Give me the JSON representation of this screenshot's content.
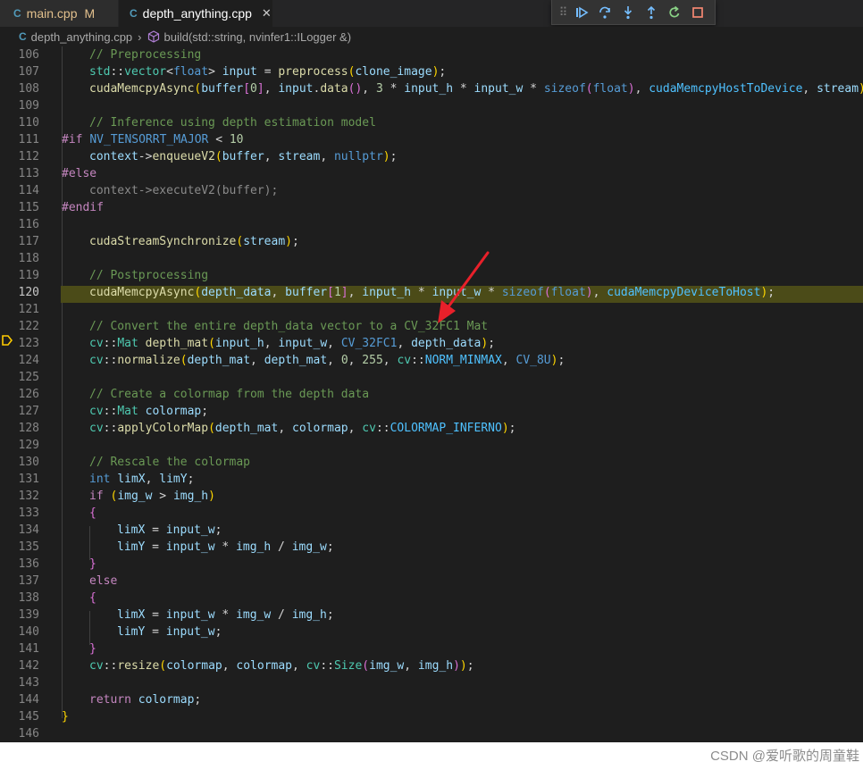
{
  "tabs": [
    {
      "icon": "C",
      "label": "main.cpp",
      "badge": "M"
    },
    {
      "icon": "C",
      "label": "depth_anything.cpp",
      "close": "✕"
    }
  ],
  "breadcrumb": {
    "file": "depth_anything.cpp",
    "symbol": "build(std::string, nvinfer1::ILogger &)"
  },
  "debug_toolbar": {
    "buttons": [
      "continue",
      "step-over",
      "step-into",
      "step-out",
      "restart",
      "stop"
    ]
  },
  "editor": {
    "current_line": 120,
    "line_numbers": [
      "106",
      "107",
      "108",
      "109",
      "110",
      "111",
      "112",
      "113",
      "114",
      "115",
      "116",
      "117",
      "118",
      "119",
      "120",
      "121",
      "122",
      "123",
      "124",
      "125",
      "126",
      "127",
      "128",
      "129",
      "130",
      "131",
      "132",
      "133",
      "134",
      "135",
      "136",
      "137",
      "138",
      "139",
      "140",
      "141",
      "142",
      "143",
      "144",
      "145",
      "146"
    ]
  },
  "code": {
    "l106": "// Preprocessing",
    "l107": "std::vector<float> input = preprocess(clone_image);",
    "l108": "cudaMemcpyAsync(buffer[0], input.data(), 3 * input_h * input_w * sizeof(float), cudaMemcpyHostToDevice, stream);",
    "l110": "// Inference using depth estimation model",
    "l111": "#if NV_TENSORRT_MAJOR < 10",
    "l112": "context->enqueueV2(buffer, stream, nullptr);",
    "l113": "#else",
    "l114": "context->executeV2(buffer);",
    "l115": "#endif",
    "l117": "cudaStreamSynchronize(stream);",
    "l119": "// Postprocessing",
    "l120": "cudaMemcpyAsync(depth_data, buffer[1], input_h * input_w * sizeof(float), cudaMemcpyDeviceToHost);",
    "l122": "// Convert the entire depth_data vector to a CV_32FC1 Mat",
    "l123": "cv::Mat depth_mat(input_h, input_w, CV_32FC1, depth_data);",
    "l124": "cv::normalize(depth_mat, depth_mat, 0, 255, cv::NORM_MINMAX, CV_8U);",
    "l126": "// Create a colormap from the depth data",
    "l127": "cv::Mat colormap;",
    "l128": "cv::applyColorMap(depth_mat, colormap, cv::COLORMAP_INFERNO);",
    "l130": "// Rescale the colormap",
    "l131": "int limX, limY;",
    "l132": "if (img_w > img_h)",
    "l133": "{",
    "l134": "limX = input_w;",
    "l135": "limY = input_w * img_h / img_w;",
    "l136": "}",
    "l137": "else",
    "l138": "{",
    "l139": "limX = input_w * img_w / img_h;",
    "l140": "limY = input_w;",
    "l141": "}",
    "l142": "cv::resize(colormap, colormap, cv::Size(img_w, img_h));",
    "l144": "return colormap;",
    "l145": "}"
  },
  "watermark": "CSDN @爱听歌的周童鞋",
  "colors": {
    "background": "#1e1e1e",
    "current_line_highlight": "#4b4b18",
    "breakpoint": "#ffcc00",
    "annotation_arrow": "#e8202a",
    "comment": "#6a9955",
    "keyword": "#569cd6",
    "function": "#dcdcaa"
  }
}
